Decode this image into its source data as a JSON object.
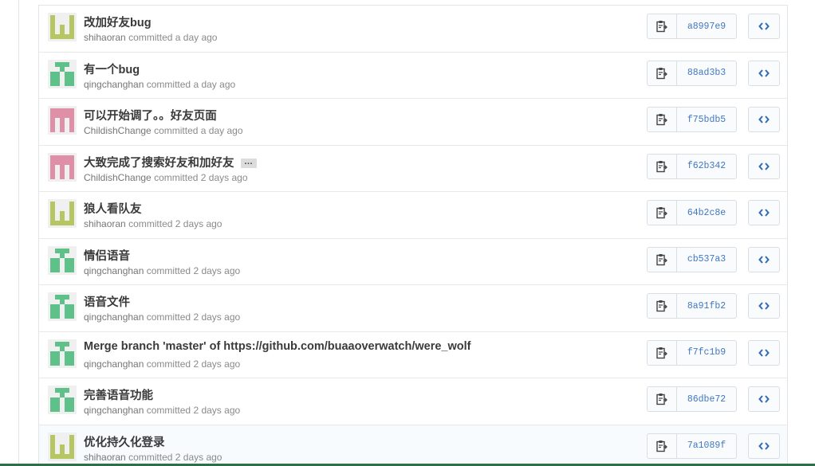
{
  "colors": {
    "sha_link": "#4078c0",
    "avatar_olive": "#b5c663",
    "avatar_green": "#5ec18a",
    "avatar_pink": "#df8fa7"
  },
  "icons": {
    "copy": "clippy-icon",
    "browse": "code-icon",
    "more": "ellipsis-icon"
  },
  "commits": [
    {
      "title": "改加好友bug",
      "author": "shihaoran",
      "committed": "committed",
      "time": "a day ago",
      "sha": "a8997e9",
      "avatar": "olive"
    },
    {
      "title": "有一个bug",
      "author": "qingchanghan",
      "committed": "committed",
      "time": "a day ago",
      "sha": "88ad3b3",
      "avatar": "green"
    },
    {
      "title": "可以开始调了。。好友页面",
      "author": "ChildishChange",
      "committed": "committed",
      "time": "a day ago",
      "sha": "f75bdb5",
      "avatar": "pink"
    },
    {
      "title": "大致完成了搜索好友和加好友",
      "ellipsis": "…",
      "author": "ChildishChange",
      "committed": "committed",
      "time": "2 days ago",
      "sha": "f62b342",
      "avatar": "pink"
    },
    {
      "title": "狼人看队友",
      "author": "shihaoran",
      "committed": "committed",
      "time": "2 days ago",
      "sha": "64b2c8e",
      "avatar": "olive"
    },
    {
      "title": "情侣语音",
      "author": "qingchanghan",
      "committed": "committed",
      "time": "2 days ago",
      "sha": "cb537a3",
      "avatar": "green"
    },
    {
      "title": "语音文件",
      "author": "qingchanghan",
      "committed": "committed",
      "time": "2 days ago",
      "sha": "8a91fb2",
      "avatar": "green"
    },
    {
      "title": "Merge branch 'master' of https://github.com/buaaoverwatch/were_wolf",
      "author": "qingchanghan",
      "committed": "committed",
      "time": "2 days ago",
      "sha": "f7fc1b9",
      "avatar": "green"
    },
    {
      "title": "完善语音功能",
      "author": "qingchanghan",
      "committed": "committed",
      "time": "2 days ago",
      "sha": "86dbe72",
      "avatar": "green"
    },
    {
      "title": "优化持久化登录",
      "author": "shihaoran",
      "committed": "committed",
      "time": "2 days ago",
      "sha": "7a1089f",
      "avatar": "olive"
    }
  ]
}
